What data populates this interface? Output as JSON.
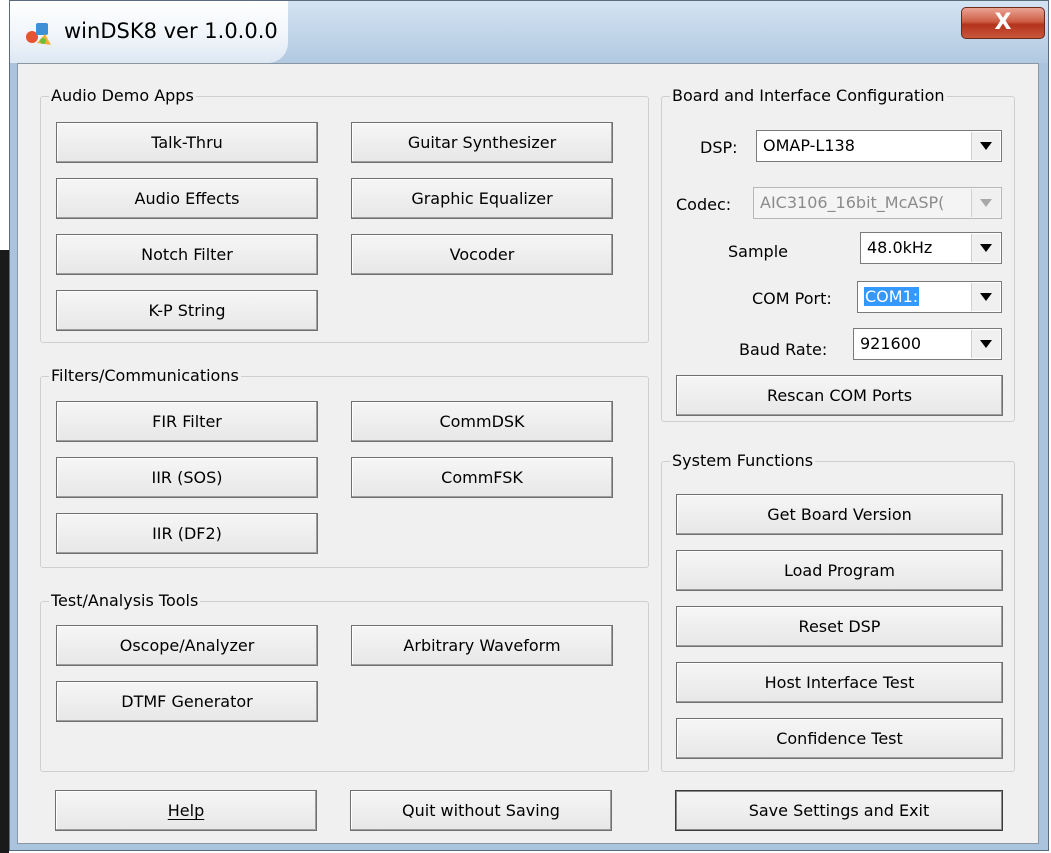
{
  "window": {
    "title": "winDSK8  ver 1.0.0.0",
    "close_symbol": "X",
    "icon": "app-icon"
  },
  "audio_demo": {
    "title": "Audio Demo Apps",
    "buttons": [
      "Talk-Thru",
      "Guitar Synthesizer",
      "Audio Effects",
      "Graphic Equalizer",
      "Notch Filter",
      "Vocoder",
      "K-P String"
    ]
  },
  "filters": {
    "title": "Filters/Communications",
    "buttons": [
      "FIR Filter",
      "CommDSK",
      "IIR (SOS)",
      "CommFSK",
      "IIR (DF2)"
    ]
  },
  "test_tools": {
    "title": "Test/Analysis Tools",
    "buttons": [
      "Oscope/Analyzer",
      "Arbitrary Waveform",
      "DTMF Generator"
    ]
  },
  "board_config": {
    "title": "Board and Interface Configuration",
    "dsp_label": "DSP:",
    "dsp_value": "OMAP-L138",
    "codec_label": "Codec:",
    "codec_value": "AIC3106_16bit_McASP(",
    "sample_label": "Sample",
    "sample_value": "48.0kHz",
    "com_label": "COM Port:",
    "com_value": "COM1:",
    "baud_label": "Baud Rate:",
    "baud_value": "921600",
    "rescan_label": "Rescan COM Ports"
  },
  "system_functions": {
    "title": "System Functions",
    "buttons": [
      "Get Board Version",
      "Load Program",
      "Reset DSP",
      "Host Interface Test",
      "Confidence Test"
    ]
  },
  "footer": {
    "help_label": "Help",
    "quit_label": "Quit without Saving",
    "save_label": "Save Settings and Exit"
  },
  "colors": {
    "selection": "#3399ff",
    "dialog_bg": "#f0f0f0",
    "close_red": "#c8463a",
    "frame": "#abc4dd"
  }
}
